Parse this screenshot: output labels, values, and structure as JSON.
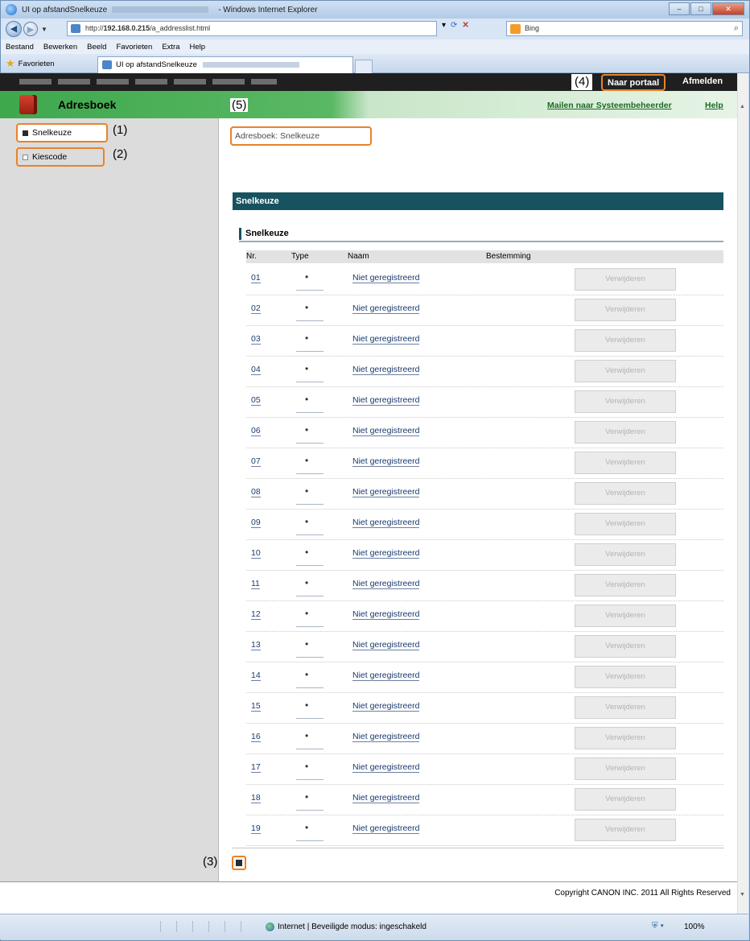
{
  "browser": {
    "title_prefix": "UI op afstandSnelkeuze",
    "title_suffix": "- Windows Internet Explorer",
    "url_prefix": "http://",
    "url_host": "192.168.0.215",
    "url_path": "/a_addresslist.html",
    "search_placeholder": "Bing",
    "menu": [
      "Bestand",
      "Bewerken",
      "Beeld",
      "Favorieten",
      "Extra",
      "Help"
    ],
    "favorites_label": "Favorieten",
    "tab_label": "UI op afstandSnelkeuze",
    "status_zone": "Internet | Beveiligde modus: ingeschakeld",
    "zoom": "100%"
  },
  "header": {
    "portal_button": "Naar portaal",
    "logout_link": "Afmelden",
    "app_title": "Adresboek",
    "mail_admin_link": "Mailen naar Systeembeheerder",
    "help_link": "Help"
  },
  "annotations": {
    "a1": "(1)",
    "a2": "(2)",
    "a3": "(3)",
    "a4": "(4)",
    "a5": "(5)"
  },
  "sidebar": {
    "items": [
      {
        "label": "Snelkeuze"
      },
      {
        "label": "Kiescode"
      }
    ]
  },
  "main": {
    "breadcrumb": "Adresboek: Snelkeuze",
    "section_title": "Snelkeuze",
    "subsection_title": "Snelkeuze",
    "columns": {
      "nr": "Nr.",
      "type": "Type",
      "naam": "Naam",
      "bestemming": "Bestemming"
    },
    "rows": [
      {
        "nr": "01",
        "type": "•",
        "naam": "Niet geregistreerd",
        "action": "Verwijderen"
      },
      {
        "nr": "02",
        "type": "•",
        "naam": "Niet geregistreerd",
        "action": "Verwijderen"
      },
      {
        "nr": "03",
        "type": "•",
        "naam": "Niet geregistreerd",
        "action": "Verwijderen"
      },
      {
        "nr": "04",
        "type": "•",
        "naam": "Niet geregistreerd",
        "action": "Verwijderen"
      },
      {
        "nr": "05",
        "type": "•",
        "naam": "Niet geregistreerd",
        "action": "Verwijderen"
      },
      {
        "nr": "06",
        "type": "•",
        "naam": "Niet geregistreerd",
        "action": "Verwijderen"
      },
      {
        "nr": "07",
        "type": "•",
        "naam": "Niet geregistreerd",
        "action": "Verwijderen"
      },
      {
        "nr": "08",
        "type": "•",
        "naam": "Niet geregistreerd",
        "action": "Verwijderen"
      },
      {
        "nr": "09",
        "type": "•",
        "naam": "Niet geregistreerd",
        "action": "Verwijderen"
      },
      {
        "nr": "10",
        "type": "•",
        "naam": "Niet geregistreerd",
        "action": "Verwijderen"
      },
      {
        "nr": "11",
        "type": "•",
        "naam": "Niet geregistreerd",
        "action": "Verwijderen"
      },
      {
        "nr": "12",
        "type": "•",
        "naam": "Niet geregistreerd",
        "action": "Verwijderen"
      },
      {
        "nr": "13",
        "type": "•",
        "naam": "Niet geregistreerd",
        "action": "Verwijderen"
      },
      {
        "nr": "14",
        "type": "•",
        "naam": "Niet geregistreerd",
        "action": "Verwijderen"
      },
      {
        "nr": "15",
        "type": "•",
        "naam": "Niet geregistreerd",
        "action": "Verwijderen"
      },
      {
        "nr": "16",
        "type": "•",
        "naam": "Niet geregistreerd",
        "action": "Verwijderen"
      },
      {
        "nr": "17",
        "type": "•",
        "naam": "Niet geregistreerd",
        "action": "Verwijderen"
      },
      {
        "nr": "18",
        "type": "•",
        "naam": "Niet geregistreerd",
        "action": "Verwijderen"
      },
      {
        "nr": "19",
        "type": "•",
        "naam": "Niet geregistreerd",
        "action": "Verwijderen"
      }
    ]
  },
  "footer": {
    "copyright": "Copyright CANON INC. 2011 All Rights Reserved"
  },
  "colors": {
    "header_green": "#3ea84d",
    "section_teal": "#17525f",
    "highlight_orange": "#e8832a"
  }
}
